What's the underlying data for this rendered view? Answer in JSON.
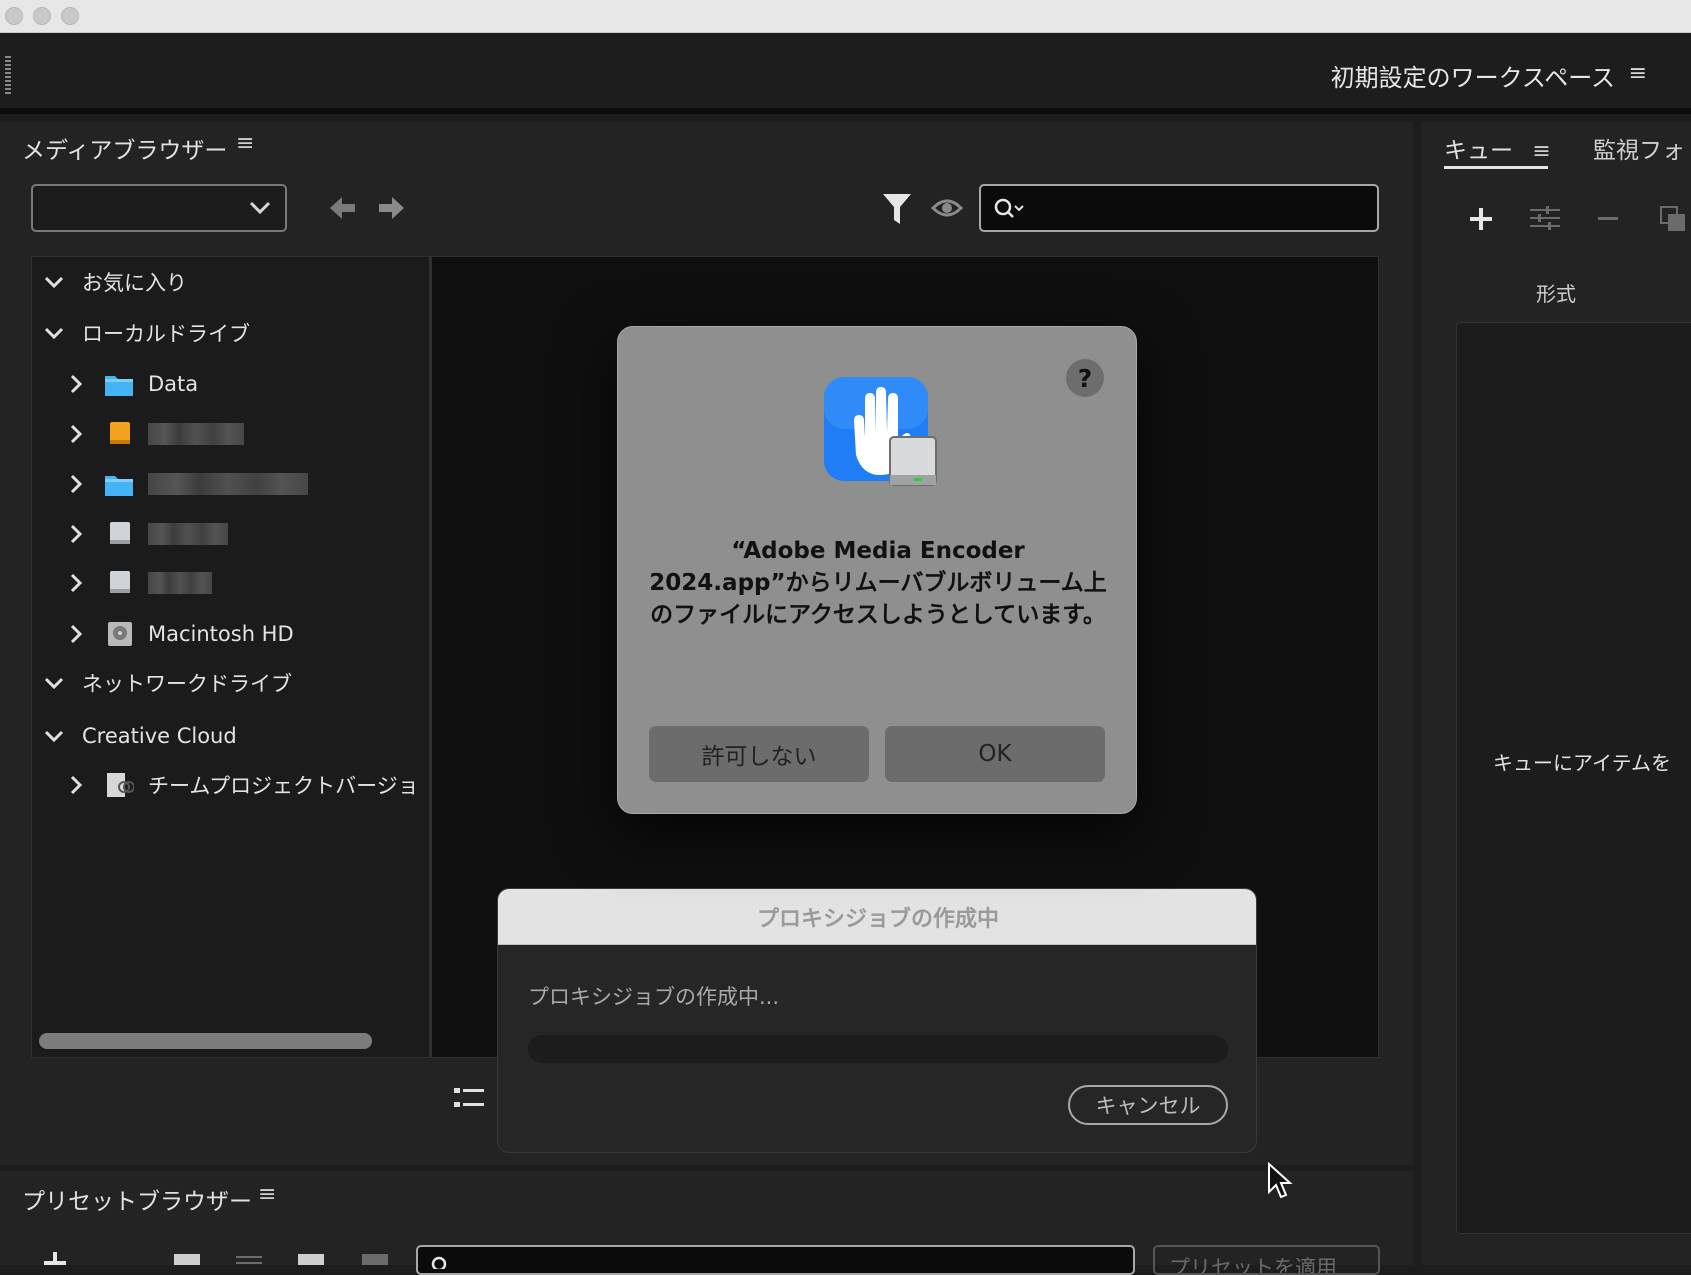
{
  "workspace": {
    "title": "初期設定のワークスペース"
  },
  "media_browser": {
    "title": "メディアブラウザー",
    "location_select_value": "",
    "search_placeholder": "",
    "tree": {
      "favorites": "お気に入り",
      "local_drives": "ローカルドライブ",
      "items": [
        {
          "label": "Data",
          "icon": "folder-blue"
        },
        {
          "label": "",
          "icon": "drive-orange",
          "redacted": true
        },
        {
          "label": "",
          "icon": "folder-blue",
          "redacted": true
        },
        {
          "label": "",
          "icon": "drive-gray",
          "redacted": true
        },
        {
          "label": "",
          "icon": "drive-gray",
          "redacted": true
        },
        {
          "label": "Macintosh HD",
          "icon": "hard-drive"
        }
      ],
      "network_drives": "ネットワークドライブ",
      "creative_cloud": "Creative Cloud",
      "cc_items": [
        {
          "label": "チームプロジェクトバージョ",
          "icon": "team-project"
        }
      ]
    }
  },
  "queue_panel": {
    "tab_queue": "キュー",
    "tab_watch": "監視フォ",
    "column_format": "形式",
    "empty_text": "キューにアイテムを"
  },
  "preset_browser": {
    "title": "プリセットブラウザー",
    "apply_label": "プリセットを適用"
  },
  "permission_dialog": {
    "message": "“Adobe Media Encoder 2024.app”からリムーバブルボリューム上のファイルにアクセスしようとしています。",
    "deny_label": "許可しない",
    "ok_label": "OK",
    "help_label": "?"
  },
  "proxy_dialog": {
    "title": "プロキシジョブの作成中",
    "status": "プロキシジョブの作成中...",
    "progress": 0,
    "cancel_label": "キャンセル"
  },
  "colors": {
    "accent_blue": "#3b8ef0",
    "folder_blue": "#45b4f5",
    "drive_orange": "#f3a21e"
  }
}
